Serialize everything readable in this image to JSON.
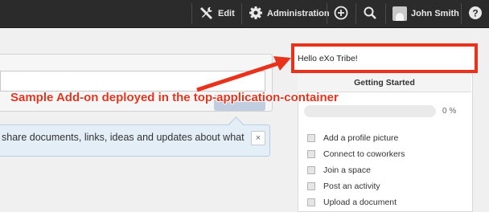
{
  "topbar": {
    "edit_label": "Edit",
    "admin_label": "Administration",
    "user_name": "John Smith"
  },
  "hint": {
    "text": "share documents, links, ideas and updates about what",
    "close_symbol": "×"
  },
  "hello": {
    "text": "Hello eXo Tribe!"
  },
  "getting_started": {
    "title": "Getting Started",
    "progress": 0,
    "progress_label": "0 %",
    "items": [
      {
        "label": "Add a profile picture"
      },
      {
        "label": "Connect to coworkers"
      },
      {
        "label": "Join a space"
      },
      {
        "label": "Post an activity"
      },
      {
        "label": "Upload a document"
      }
    ]
  },
  "annotation": {
    "text": "Sample Add-on deployed in the top-application-container",
    "color": "#e8321b"
  }
}
